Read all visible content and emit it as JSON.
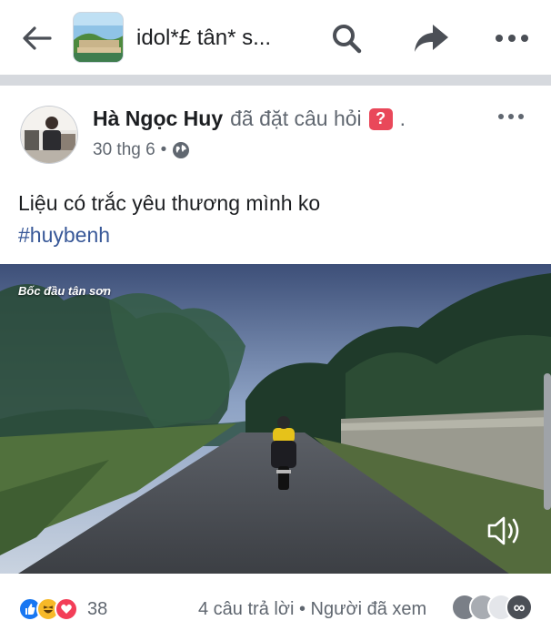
{
  "header": {
    "group_title": "idol*£ tân* s...",
    "icons": [
      "back-arrow-icon",
      "group-thumbnail",
      "search-icon",
      "share-icon",
      "more-icon"
    ]
  },
  "post": {
    "author": "Hà Ngọc Huy",
    "action": "đã đặt câu hỏi",
    "question_badge": "?",
    "end_dot": ".",
    "date": "30 thg 6",
    "meta_separator": "•",
    "privacy_icon": "globe-icon",
    "text": "Liệu có trắc yêu thương mình ko",
    "hashtag": "#huybenh",
    "video": {
      "caption": "Bốc đầu tân sơn",
      "mute_icon": "speaker-icon"
    }
  },
  "footer": {
    "reaction_icons": [
      "like-icon",
      "haha-icon",
      "love-icon"
    ],
    "reaction_count": "38",
    "answers_text": "4 câu trả lời • Người đã xem",
    "seen_more": "∞"
  },
  "colors": {
    "link": "#385898",
    "secondary_text": "#606770",
    "divider": "#d6d9de",
    "like": "#1877f2",
    "haha": "#f7b928",
    "love": "#f33e58"
  }
}
